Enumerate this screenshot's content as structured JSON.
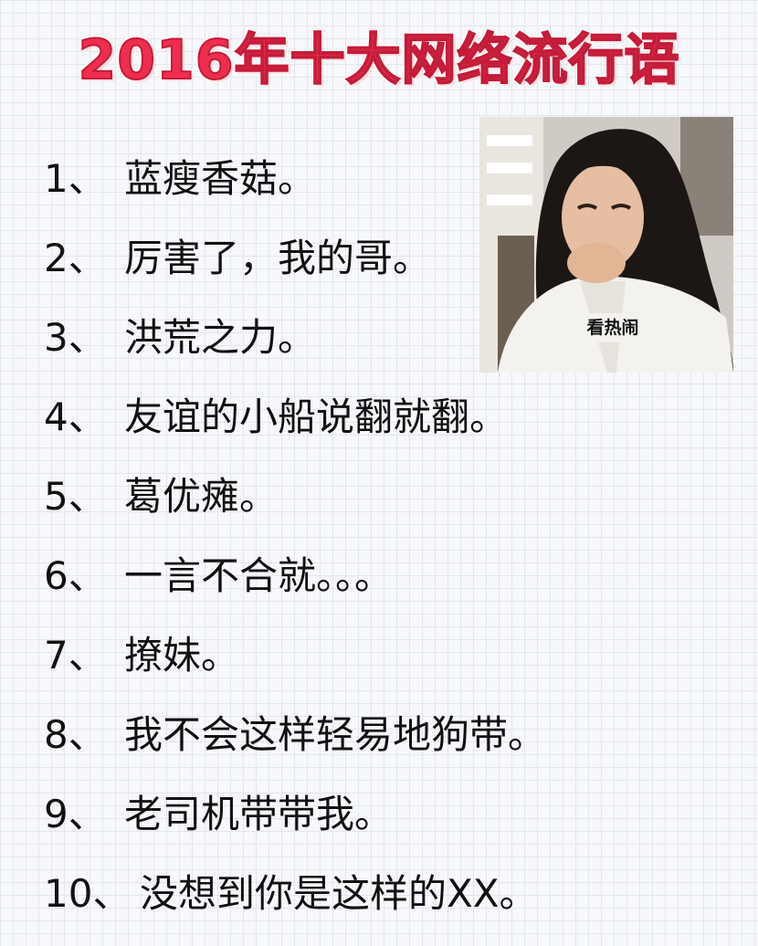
{
  "title": "2016年十大网络流行语",
  "meme_caption": "看热闹",
  "items": [
    {
      "num": "1、",
      "text": "蓝瘦香菇。"
    },
    {
      "num": "2、",
      "text": "厉害了，我的哥。"
    },
    {
      "num": "3、",
      "text": "洪荒之力。"
    },
    {
      "num": "4、",
      "text": "友谊的小船说翻就翻。"
    },
    {
      "num": "5、",
      "text": "葛优瘫。"
    },
    {
      "num": "6、",
      "text": "一言不合就。。。"
    },
    {
      "num": "7、",
      "text": "撩妹。"
    },
    {
      "num": "8、",
      "text": "我不会这样轻易地狗带。"
    },
    {
      "num": "9、",
      "text": "老司机带带我。"
    },
    {
      "num": "10、",
      "text": "没想到你是这样的XX。"
    }
  ]
}
